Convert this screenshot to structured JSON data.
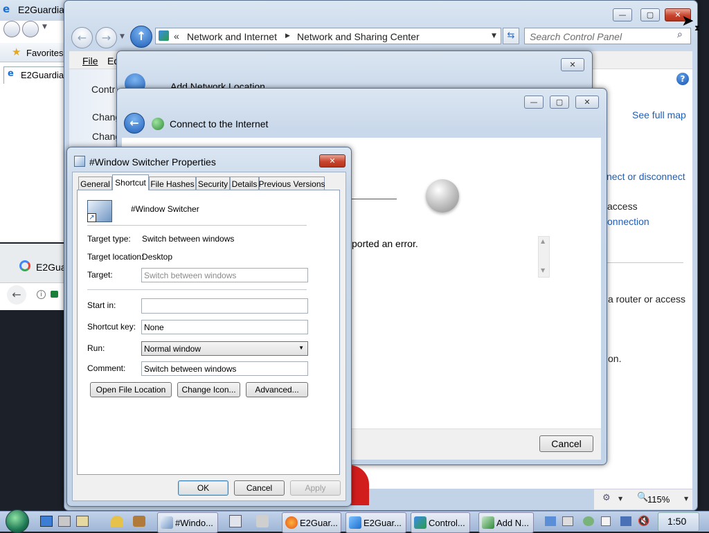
{
  "browser_ie": {
    "tab_title": "E2Guardia",
    "favorites_label": "Favorites",
    "tab2_title": "E2Guardia"
  },
  "chrome_bg": {
    "tab_title": "E2Guar"
  },
  "control_panel": {
    "breadcrumb": [
      "Network and Internet",
      "Network and Sharing Center"
    ],
    "breadcrumb_prefix": "«",
    "search_placeholder": "Search Control Panel",
    "menu": [
      "File",
      "Ed"
    ],
    "left_items": [
      "Contr",
      "Chang",
      "Chang"
    ],
    "right_links": {
      "see_full_map": "See full map",
      "connect": "nect or disconnect",
      "access1": "access",
      "connection": "onnection",
      "router": "a router or access",
      "on": "on."
    },
    "status_zoom": "115%"
  },
  "add_network": {
    "title": "Add Network Location"
  },
  "connect_internet": {
    "title": "Connect to the Internet",
    "error_text": "ported an error.",
    "cancel_label": "Cancel"
  },
  "props": {
    "title": "#Window Switcher Properties",
    "tabs": [
      "General",
      "Shortcut",
      "File Hashes",
      "Security",
      "Details",
      "Previous Versions"
    ],
    "active_tab": "Shortcut",
    "shortcut_name": "#Window Switcher",
    "target_type_label": "Target type:",
    "target_type_value": "Switch between windows",
    "target_location_label": "Target location:",
    "target_location_value": "Desktop",
    "target_label": "Target:",
    "target_value": "Switch between windows",
    "start_in_label": "Start in:",
    "start_in_value": "",
    "shortcut_key_label": "Shortcut key:",
    "shortcut_key_value": "None",
    "run_label": "Run:",
    "run_value": "Normal window",
    "comment_label": "Comment:",
    "comment_value": "Switch between windows",
    "open_file_location": "Open File Location",
    "change_icon": "Change Icon...",
    "advanced": "Advanced...",
    "ok": "OK",
    "cancel": "Cancel",
    "apply": "Apply"
  },
  "taskbar": {
    "items": [
      "#Windo...",
      "E2Guar...",
      "E2Guar...",
      "Control...",
      "Add N..."
    ],
    "clock": "1:50"
  },
  "colors": {
    "desktop": "#1c2029",
    "link": "#1e5eb8",
    "close_red": "#c8442e"
  }
}
